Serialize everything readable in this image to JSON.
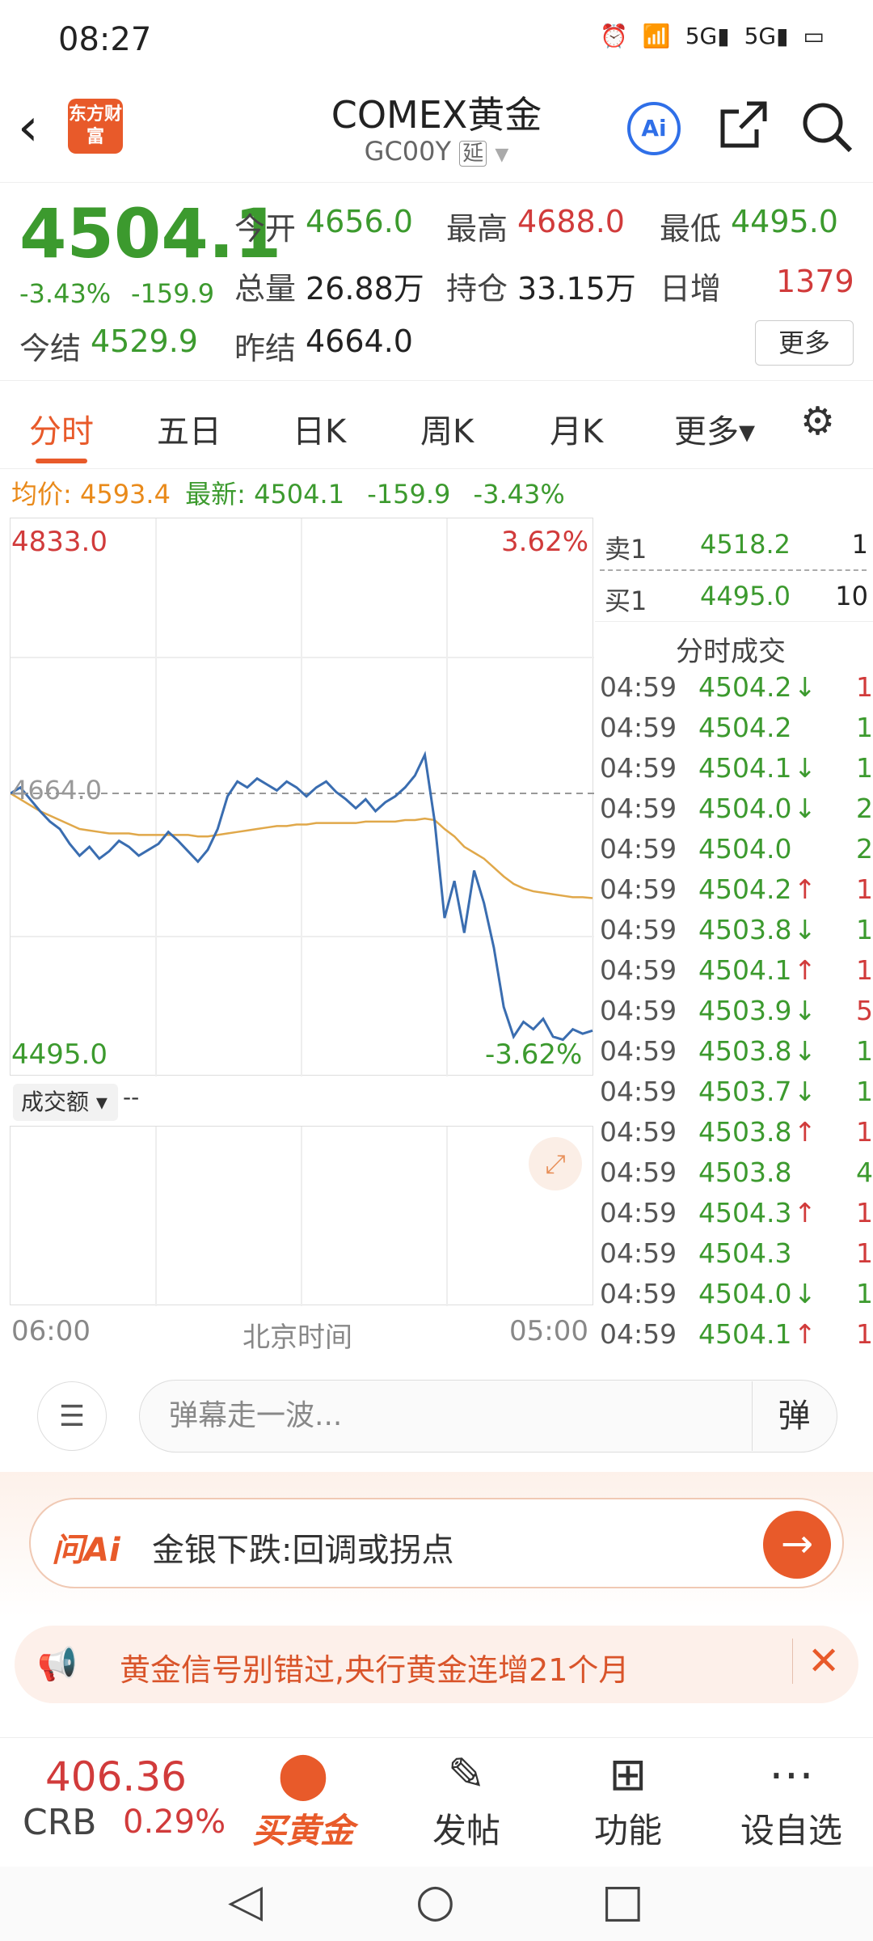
{
  "status": {
    "time": "08:27",
    "icons": [
      "alarm-icon",
      "wifi-icon",
      "signal-5g-icon",
      "signal-5g-icon",
      "battery-icon"
    ]
  },
  "header": {
    "logo_text": "东方财富",
    "title": "COMEX黄金",
    "subtitle": "GC00Y",
    "subtitle_tag": "延",
    "ai_label": "Ai"
  },
  "quote": {
    "price": "4504.1",
    "change_pct": "-3.43%",
    "change_abs": "-159.9",
    "items": [
      {
        "label": "今开",
        "value": "4656.0",
        "color": "#3c9a2e"
      },
      {
        "label": "最高",
        "value": "4688.0",
        "color": "#d13b3b"
      },
      {
        "label": "最低",
        "value": "4495.0",
        "color": "#3c9a2e"
      },
      {
        "label": "总量",
        "value": "26.88万",
        "color": "#222222"
      },
      {
        "label": "持仓",
        "value": "33.15万",
        "color": "#222222"
      },
      {
        "label": "日增",
        "value": "1379",
        "color": "#d13b3b"
      },
      {
        "label": "今结",
        "value": "4529.9",
        "color": "#3c9a2e"
      },
      {
        "label": "昨结",
        "value": "4664.0",
        "color": "#222222"
      }
    ],
    "more_label": "更多"
  },
  "tabs": [
    "分时",
    "五日",
    "日K",
    "周K",
    "月K",
    "更多▾"
  ],
  "avg_row": {
    "avg_label": "均价:",
    "avg_value": "4593.4",
    "latest_label": "最新:",
    "latest_value": "4504.1",
    "latest_change": "-159.9",
    "latest_pct": "-3.43%"
  },
  "chart": {
    "top_left": "4833.0",
    "top_right": "3.62%",
    "bottom_left": "4495.0",
    "bottom_right": "-3.62%",
    "ref_label": "4664.0",
    "volume_label": "成交额 ▾",
    "volume_value": "--",
    "x_start": "06:00",
    "x_mid": "北京时间",
    "x_end": "05:00"
  },
  "chart_data": {
    "type": "line",
    "ylim": [
      4495.0,
      4833.0
    ],
    "prev_settle": 4664.0,
    "series": [],
    "price": [
      4664,
      4668,
      4660,
      4652,
      4645,
      4640,
      4630,
      4622,
      4628,
      4620,
      4625,
      4632,
      4628,
      4622,
      4626,
      4630,
      4638,
      4632,
      4625,
      4618,
      4626,
      4640,
      4662,
      4672,
      4668,
      4674,
      4670,
      4666,
      4672,
      4668,
      4662,
      4668,
      4672,
      4665,
      4660,
      4654,
      4660,
      4652,
      4658,
      4662,
      4668,
      4676,
      4690,
      4645,
      4580,
      4605,
      4570,
      4612,
      4590,
      4560,
      4520,
      4500,
      4510,
      4505,
      4512,
      4500,
      4498,
      4505,
      4502,
      4504.1
    ],
    "avg": [
      4664,
      4660,
      4656,
      4652,
      4649,
      4646,
      4643,
      4640,
      4639,
      4638,
      4637,
      4637,
      4637,
      4636,
      4636,
      4636,
      4636,
      4636,
      4636,
      4635,
      4635,
      4636,
      4637,
      4638,
      4639,
      4640,
      4641,
      4642,
      4642,
      4643,
      4643,
      4644,
      4644,
      4644,
      4644,
      4644,
      4645,
      4645,
      4645,
      4645,
      4646,
      4646,
      4647,
      4646,
      4640,
      4635,
      4628,
      4624,
      4620,
      4614,
      4608,
      4603,
      4600,
      4598,
      4597,
      4596,
      4595,
      4594,
      4594,
      4593.4
    ]
  },
  "order_book": {
    "ask": {
      "label": "卖1",
      "price": "4518.2",
      "volume": "1"
    },
    "bid": {
      "label": "买1",
      "price": "4495.0",
      "volume": "10"
    },
    "title": "分时成交"
  },
  "trades": [
    {
      "time": "04:59",
      "price": "4504.2",
      "arrow": "↓",
      "vol": "1",
      "color": "#3c9a2e",
      "vol_color": "#d13b3b"
    },
    {
      "time": "04:59",
      "price": "4504.2",
      "arrow": "",
      "vol": "1",
      "color": "#3c9a2e",
      "vol_color": "#3c9a2e"
    },
    {
      "time": "04:59",
      "price": "4504.1",
      "arrow": "↓",
      "vol": "1",
      "color": "#3c9a2e",
      "vol_color": "#3c9a2e"
    },
    {
      "time": "04:59",
      "price": "4504.0",
      "arrow": "↓",
      "vol": "2",
      "color": "#3c9a2e",
      "vol_color": "#3c9a2e"
    },
    {
      "time": "04:59",
      "price": "4504.0",
      "arrow": "",
      "vol": "2",
      "color": "#3c9a2e",
      "vol_color": "#3c9a2e"
    },
    {
      "time": "04:59",
      "price": "4504.2",
      "arrow": "↑",
      "vol": "1",
      "color": "#3c9a2e",
      "vol_color": "#d13b3b"
    },
    {
      "time": "04:59",
      "price": "4503.8",
      "arrow": "↓",
      "vol": "1",
      "color": "#3c9a2e",
      "vol_color": "#3c9a2e"
    },
    {
      "time": "04:59",
      "price": "4504.1",
      "arrow": "↑",
      "vol": "1",
      "color": "#3c9a2e",
      "vol_color": "#d13b3b"
    },
    {
      "time": "04:59",
      "price": "4503.9",
      "arrow": "↓",
      "vol": "5",
      "color": "#3c9a2e",
      "vol_color": "#d13b3b"
    },
    {
      "time": "04:59",
      "price": "4503.8",
      "arrow": "↓",
      "vol": "1",
      "color": "#3c9a2e",
      "vol_color": "#3c9a2e"
    },
    {
      "time": "04:59",
      "price": "4503.7",
      "arrow": "↓",
      "vol": "1",
      "color": "#3c9a2e",
      "vol_color": "#3c9a2e"
    },
    {
      "time": "04:59",
      "price": "4503.8",
      "arrow": "↑",
      "vol": "1",
      "color": "#3c9a2e",
      "vol_color": "#d13b3b"
    },
    {
      "time": "04:59",
      "price": "4503.8",
      "arrow": "",
      "vol": "4",
      "color": "#3c9a2e",
      "vol_color": "#3c9a2e"
    },
    {
      "time": "04:59",
      "price": "4504.3",
      "arrow": "↑",
      "vol": "1",
      "color": "#3c9a2e",
      "vol_color": "#d13b3b"
    },
    {
      "time": "04:59",
      "price": "4504.3",
      "arrow": "",
      "vol": "1",
      "color": "#3c9a2e",
      "vol_color": "#d13b3b"
    },
    {
      "time": "04:59",
      "price": "4504.0",
      "arrow": "↓",
      "vol": "1",
      "color": "#3c9a2e",
      "vol_color": "#3c9a2e"
    },
    {
      "time": "04:59",
      "price": "4504.1",
      "arrow": "↑",
      "vol": "1",
      "color": "#3c9a2e",
      "vol_color": "#d13b3b"
    }
  ],
  "comment": {
    "placeholder": "弹幕走一波...",
    "send_label": "弹"
  },
  "ai_banner": {
    "brand": "问Ai",
    "question": "金银下跌:回调或拐点"
  },
  "notice": {
    "text": "黄金信号别错过,央行黄金连增21个月"
  },
  "bottom_nav": {
    "crb_price": "406.36",
    "crb_name": "CRB",
    "crb_pct": "0.29%",
    "items": [
      {
        "label": "买黄金",
        "icon": "gold-bars-icon"
      },
      {
        "label": "发帖",
        "icon": "edit-icon"
      },
      {
        "label": "功能",
        "icon": "grid-icon"
      },
      {
        "label": "设自选",
        "icon": "more-dots-icon"
      }
    ]
  },
  "colors": {
    "up": "#d13b3b",
    "down": "#3c9a2e",
    "accent": "#e85a2a",
    "price_line": "#3a6db0",
    "avg_line": "#e0a84a"
  }
}
